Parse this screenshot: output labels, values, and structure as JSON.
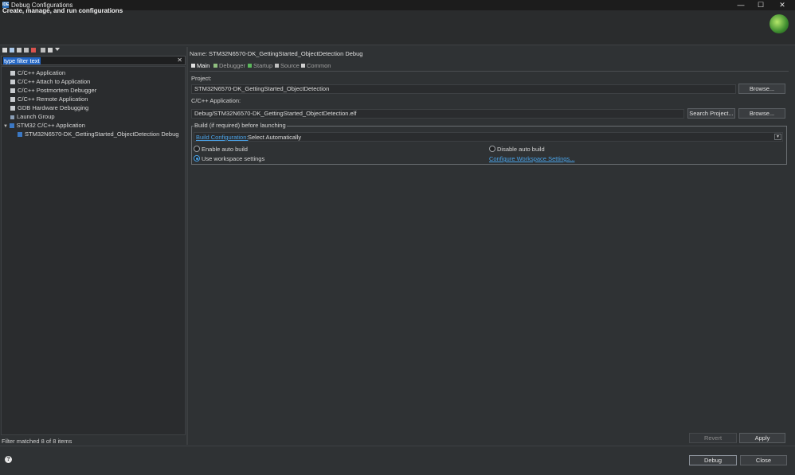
{
  "window": {
    "title": "Debug Configurations",
    "app_icon": "IDE",
    "minimize": "—",
    "maximize": "☐",
    "close": "✕"
  },
  "header": {
    "title": "Create, manage, and run configurations"
  },
  "left": {
    "filter_text": "type filter text",
    "filter_clear": "✕",
    "tree": [
      {
        "label": "C/C++ Application",
        "icon": "c-app-icon"
      },
      {
        "label": "C/C++ Attach to Application",
        "icon": "c-attach-icon"
      },
      {
        "label": "C/C++ Postmortem Debugger",
        "icon": "c-postmortem-icon"
      },
      {
        "label": "C/C++ Remote Application",
        "icon": "c-remote-icon"
      },
      {
        "label": "GDB Hardware Debugging",
        "icon": "gdb-hw-icon"
      },
      {
        "label": "Launch Group",
        "icon": "launch-group-icon"
      },
      {
        "label": "STM32 C/C++ Application",
        "icon": "stm32-icon"
      },
      {
        "label": "STM32N6570-DK_GettingStarted_ObjectDetection Debug",
        "icon": "config-icon"
      }
    ],
    "status": "Filter matched 8 of 8 items"
  },
  "config": {
    "name_label": "Name:",
    "name_value": "STM32N6570-DK_GettingStarted_ObjectDetection Debug",
    "tabs": [
      "Main",
      "Debugger",
      "Startup",
      "Source",
      "Common"
    ],
    "project_label": "Project:",
    "project_value": "STM32N6570-DK_GettingStarted_ObjectDetection",
    "browse_label": "Browse...",
    "app_label": "C/C++ Application:",
    "app_value": "Debug/STM32N6570-DK_GettingStarted_ObjectDetection.elf",
    "search_project_label": "Search Project...",
    "browse2_label": "Browse...",
    "build_group_title": "Build (if required) before launching",
    "build_config_link": "Build Configuration:",
    "build_config_value": "Select Automatically",
    "enable_auto_build": "Enable auto build",
    "disable_auto_build": "Disable auto build",
    "use_workspace": "Use workspace settings",
    "configure_link": "Configure Workspace Settings...",
    "revert_label": "Revert",
    "apply_label": "Apply"
  },
  "footer": {
    "help": "?",
    "debug_label": "Debug",
    "close_label": "Close"
  },
  "colors": {
    "link": "#4aa3e8",
    "selection": "#2467c5",
    "background": "#2f3234"
  }
}
